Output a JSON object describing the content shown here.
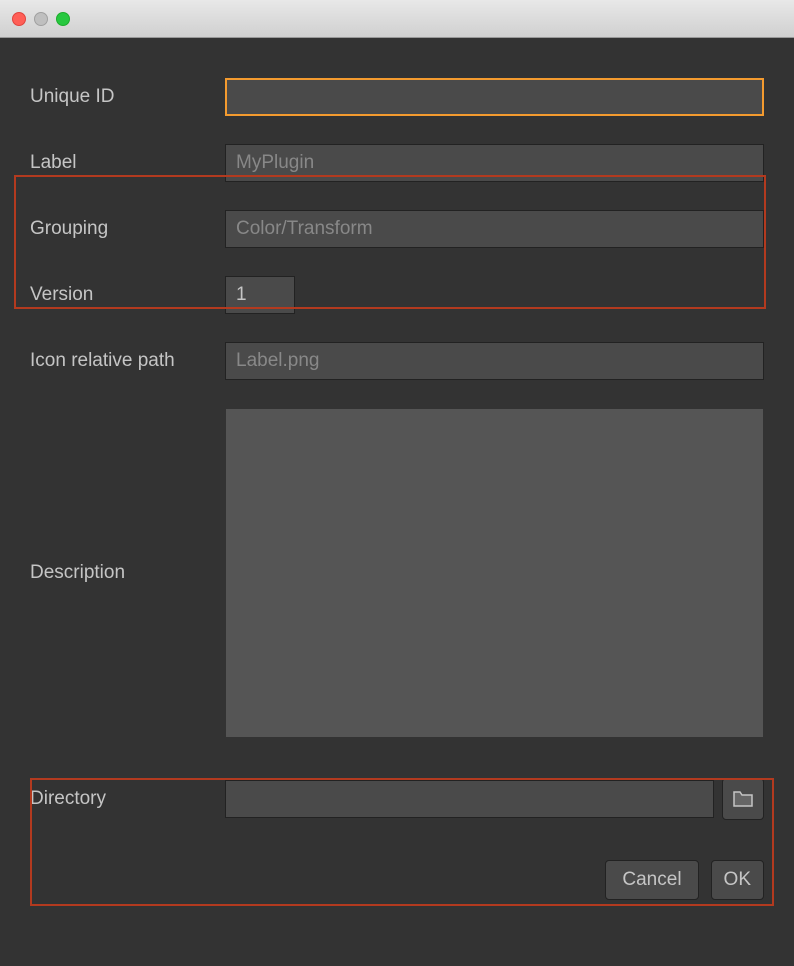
{
  "form": {
    "unique_id": {
      "label": "Unique ID",
      "value": ""
    },
    "label": {
      "label": "Label",
      "placeholder": "MyPlugin",
      "value": ""
    },
    "grouping": {
      "label": "Grouping",
      "placeholder": "Color/Transform",
      "value": ""
    },
    "version": {
      "label": "Version",
      "value": "1"
    },
    "icon_path": {
      "label": "Icon relative path",
      "placeholder": "Label.png",
      "value": ""
    },
    "description": {
      "label": "Description",
      "value": ""
    },
    "directory": {
      "label": "Directory",
      "value": ""
    }
  },
  "buttons": {
    "cancel": "Cancel",
    "ok": "OK"
  }
}
